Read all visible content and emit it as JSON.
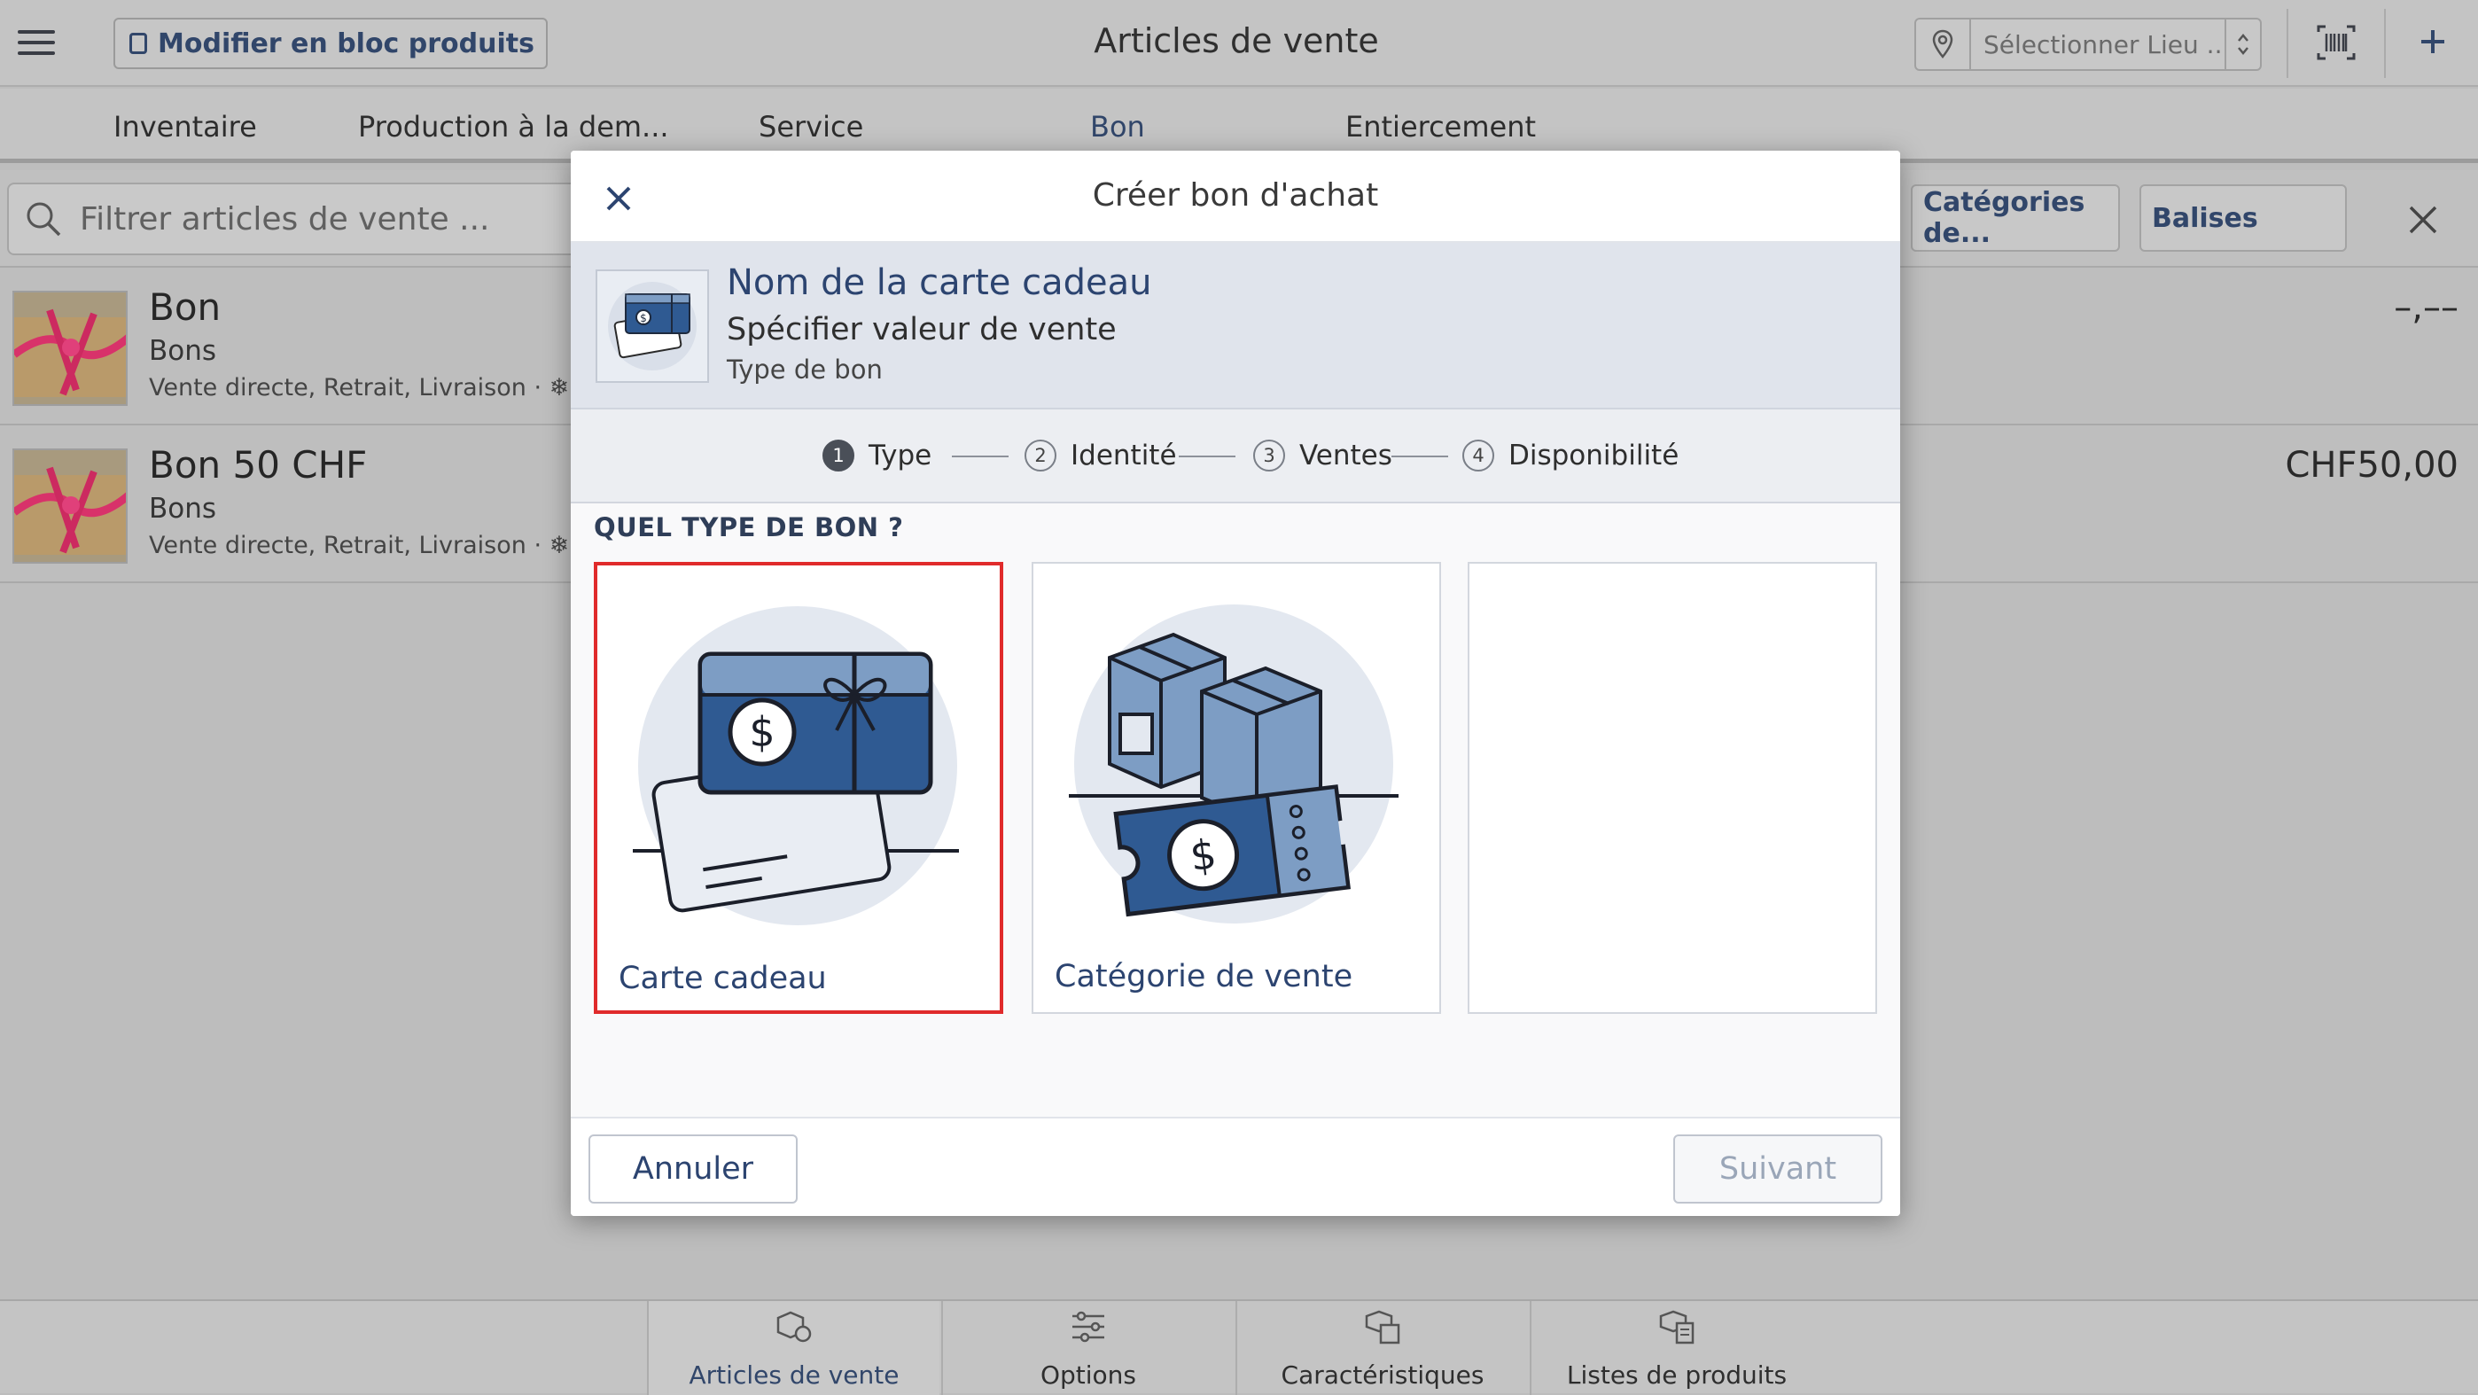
{
  "header": {
    "bulk_edit_label": "Modifier en bloc produits",
    "title": "Articles de vente",
    "location_placeholder": "Sélectionner Lieu ....."
  },
  "tabs": [
    {
      "label": "Inventaire"
    },
    {
      "label": "Production à la dem..."
    },
    {
      "label": "Service"
    },
    {
      "label": "Bon"
    },
    {
      "label": "Entiercement"
    }
  ],
  "filters": {
    "search_placeholder": "Filtrer articles de vente ...",
    "categories_label": "Catégories de...",
    "tags_label": "Balises"
  },
  "items": [
    {
      "title": "Bon",
      "subtitle": "Bons",
      "meta": "Vente directe, Retrait, Livraison · ❄ Re",
      "price": "–,––"
    },
    {
      "title": "Bon 50 CHF",
      "subtitle": "Bons",
      "meta": "Vente directe, Retrait, Livraison · ❄ Re",
      "price": "CHF50,00"
    }
  ],
  "bottom_nav": [
    {
      "label": "Articles de vente",
      "icon": "box-tag-icon"
    },
    {
      "label": "Options",
      "icon": "sliders-icon"
    },
    {
      "label": "Caractéristiques",
      "icon": "features-icon"
    },
    {
      "label": "Listes de produits",
      "icon": "product-list-icon"
    }
  ],
  "modal": {
    "title": "Créer bon d'achat",
    "info": {
      "name": "Nom de la carte cadeau",
      "value": "Spécifier valeur de vente",
      "type": "Type de bon"
    },
    "steps": [
      {
        "num": "1",
        "label": "Type"
      },
      {
        "num": "2",
        "label": "Identité"
      },
      {
        "num": "3",
        "label": "Ventes"
      },
      {
        "num": "4",
        "label": "Disponibilité"
      }
    ],
    "question": "QUEL TYPE DE BON ?",
    "options": [
      {
        "label": "Carte cadeau",
        "icon": "gift-card-icon"
      },
      {
        "label": "Catégorie de vente",
        "icon": "sales-category-icon"
      },
      {
        "label": ""
      }
    ],
    "cancel_label": "Annuler",
    "next_label": "Suivant"
  },
  "colors": {
    "accent": "#2c4470",
    "selection": "#e02b2b",
    "illustration_blue": "#2f5a92",
    "illustration_light": "#7d9dc4",
    "illustration_bg": "#e3e8f0"
  }
}
